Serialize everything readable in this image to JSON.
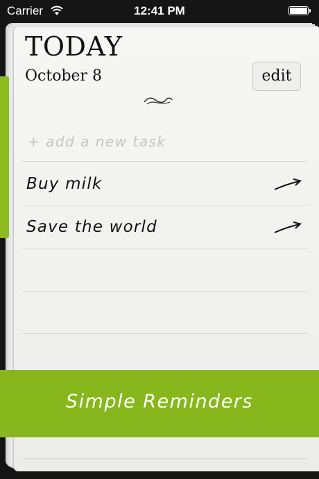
{
  "status_bar": {
    "carrier": "Carrier",
    "time": "12:41 PM",
    "battery_level": 1.0
  },
  "header": {
    "title": "TODAY",
    "date": "October 8",
    "edit_label": "edit"
  },
  "new_task": {
    "placeholder": "+ add a new task"
  },
  "tasks": [
    {
      "label": "Buy milk"
    },
    {
      "label": "Save the world"
    }
  ],
  "banner": {
    "label": "Simple Reminders"
  },
  "colors": {
    "accent_green": "#87b71d",
    "paper": "#f3f3f1",
    "ink": "#111111"
  },
  "icons": {
    "wifi": "wifi-icon",
    "battery": "battery-icon",
    "flourish": "flourish-icon",
    "task_arrow": "arrow-right-icon"
  }
}
